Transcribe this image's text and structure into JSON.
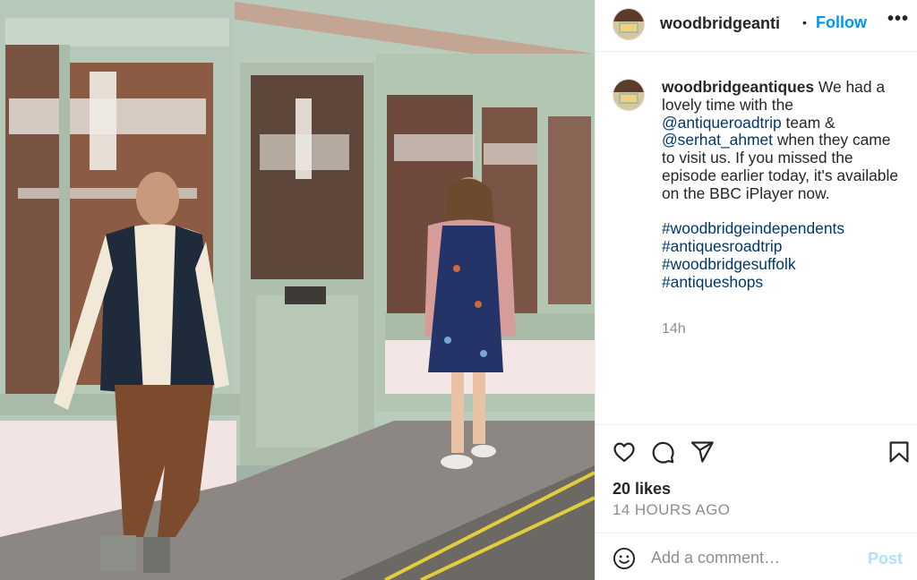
{
  "post": {
    "username": "woodbridgeantiques",
    "header_username": "woodbridgeanti",
    "dot": "•",
    "follow_label": "Follow",
    "more_label": "•••",
    "caption": {
      "username": "woodbridgeantiques",
      "text_1": " We had a lovely time with the ",
      "mention_1": "@antiqueroadtrip",
      "text_2": " team & ",
      "mention_2": "@serhat_ahmet",
      "text_3": " when they came to visit us. If you missed the episode earlier today, it's available on the BBC iPlayer now.",
      "hashtags": [
        "#woodbridgeindependents",
        "#antiquesroadtrip",
        "#woodbridgesuffolk",
        "#antiqueshops"
      ]
    },
    "relative_time": "14h",
    "likes": "20 likes",
    "posted_ago": "14 HOURS AGO",
    "comment_placeholder": "Add a comment…",
    "post_label": "Post"
  },
  "icons": {
    "like": "heart-icon",
    "comment": "comment-icon",
    "share": "paper-plane-icon",
    "save": "bookmark-icon",
    "emoji": "smiley-icon"
  },
  "colors": {
    "link_blue": "#0095f6",
    "mention_blue": "#00376b",
    "muted_gray": "#8e8e8e",
    "post_disabled": "#b2dffc",
    "divider": "#efefef"
  }
}
